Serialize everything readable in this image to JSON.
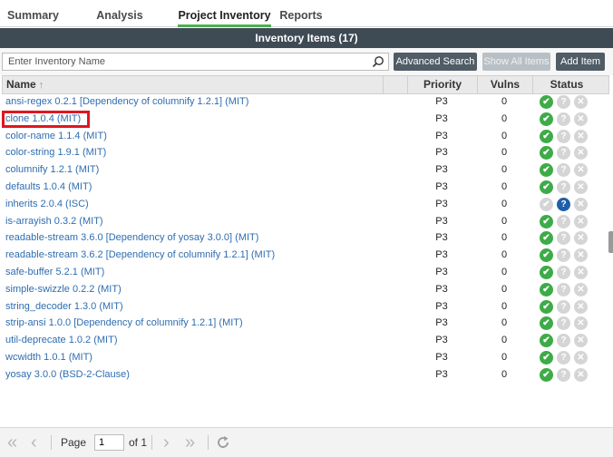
{
  "tabs": [
    {
      "label": "Summary"
    },
    {
      "label": "Analysis Workbench"
    },
    {
      "label": "Project Inventory"
    },
    {
      "label": "Reports"
    }
  ],
  "active_tab": "Project Inventory",
  "panel_title": "Inventory Items (17)",
  "search": {
    "placeholder": "Enter Inventory Name"
  },
  "toolbar": {
    "advanced_search": "Advanced Search",
    "show_all_items": "Show All Items",
    "add_item": "Add Item"
  },
  "columns": {
    "name": "Name",
    "priority": "Priority",
    "vulns": "Vulns",
    "status": "Status"
  },
  "items": [
    {
      "name": "ansi-regex 0.2.1  [Dependency of columnify 1.2.1] (MIT)",
      "priority": "P3",
      "vulns": "0",
      "status": "approved"
    },
    {
      "name": "clone 1.0.4 (MIT)",
      "priority": "P3",
      "vulns": "0",
      "status": "approved"
    },
    {
      "name": "color-name 1.1.4 (MIT)",
      "priority": "P3",
      "vulns": "0",
      "status": "approved"
    },
    {
      "name": "color-string 1.9.1 (MIT)",
      "priority": "P3",
      "vulns": "0",
      "status": "approved"
    },
    {
      "name": "columnify 1.2.1 (MIT)",
      "priority": "P3",
      "vulns": "0",
      "status": "approved"
    },
    {
      "name": "defaults 1.0.4 (MIT)",
      "priority": "P3",
      "vulns": "0",
      "status": "approved"
    },
    {
      "name": "inherits 2.0.4 (ISC)",
      "priority": "P3",
      "vulns": "0",
      "status": "pending"
    },
    {
      "name": "is-arrayish 0.3.2 (MIT)",
      "priority": "P3",
      "vulns": "0",
      "status": "approved"
    },
    {
      "name": "readable-stream 3.6.0  [Dependency of yosay 3.0.0] (MIT)",
      "priority": "P3",
      "vulns": "0",
      "status": "approved"
    },
    {
      "name": "readable-stream 3.6.2  [Dependency of columnify 1.2.1] (MIT)",
      "priority": "P3",
      "vulns": "0",
      "status": "approved"
    },
    {
      "name": "safe-buffer 5.2.1 (MIT)",
      "priority": "P3",
      "vulns": "0",
      "status": "approved"
    },
    {
      "name": "simple-swizzle 0.2.2 (MIT)",
      "priority": "P3",
      "vulns": "0",
      "status": "approved"
    },
    {
      "name": "string_decoder 1.3.0 (MIT)",
      "priority": "P3",
      "vulns": "0",
      "status": "approved"
    },
    {
      "name": "strip-ansi 1.0.0  [Dependency of columnify 1.2.1] (MIT)",
      "priority": "P3",
      "vulns": "0",
      "status": "approved"
    },
    {
      "name": "util-deprecate 1.0.2 (MIT)",
      "priority": "P3",
      "vulns": "0",
      "status": "approved"
    },
    {
      "name": "wcwidth 1.0.1 (MIT)",
      "priority": "P3",
      "vulns": "0",
      "status": "approved"
    },
    {
      "name": "yosay 3.0.0 (BSD-2-Clause)",
      "priority": "P3",
      "vulns": "0",
      "status": "approved"
    }
  ],
  "pagination": {
    "page_label": "Page",
    "current_page": "1",
    "of_label": "of 1"
  },
  "colors": {
    "accent_green": "#4caf50",
    "approved": "#3dab47",
    "pending": "#1f5ea8",
    "link": "#2f6db0",
    "highlight": "#e0161f"
  }
}
